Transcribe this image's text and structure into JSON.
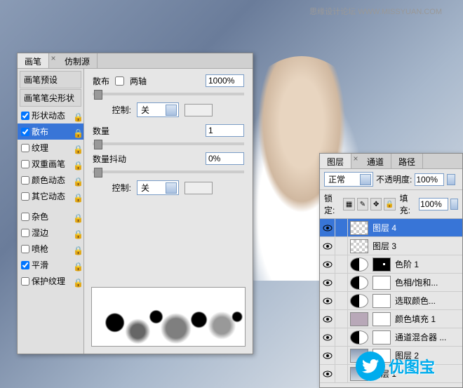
{
  "watermark": "思缘设计论坛  WWW.MISSYUAN.COM",
  "brush": {
    "tabs": {
      "brush": "画笔",
      "clone": "仿制源"
    },
    "side": {
      "preset": "画笔预设",
      "tip": "画笔笔尖形状",
      "shape": "形状动态",
      "scatter": "散布",
      "texture": "纹理",
      "dual": "双重画笔",
      "color": "颜色动态",
      "other": "其它动态",
      "noise": "杂色",
      "wet": "湿边",
      "airbrush": "喷枪",
      "smooth": "平滑",
      "protect": "保护纹理"
    },
    "labels": {
      "scatter": "散布",
      "both": "两轴",
      "control": "控制:",
      "count": "数量",
      "jitter": "数量抖动",
      "off": "关"
    },
    "values": {
      "scatter": "1000%",
      "count": "1",
      "jitter": "0%"
    }
  },
  "layers": {
    "tabs": {
      "layers": "图层",
      "channels": "通道",
      "paths": "路径"
    },
    "blend": "正常",
    "opacity_lbl": "不透明度:",
    "opacity": "100%",
    "lock_lbl": "锁定:",
    "fill_lbl": "填充:",
    "fill": "100%",
    "items": [
      {
        "name": "图层 4"
      },
      {
        "name": "图层 3"
      },
      {
        "name": "色阶 1"
      },
      {
        "name": "色相/饱和..."
      },
      {
        "name": "选取颜色..."
      },
      {
        "name": "颜色填充 1"
      },
      {
        "name": "通道混合器 ..."
      },
      {
        "name": "图层 2"
      },
      {
        "name": "图层 1"
      }
    ]
  },
  "logo": "优图宝"
}
